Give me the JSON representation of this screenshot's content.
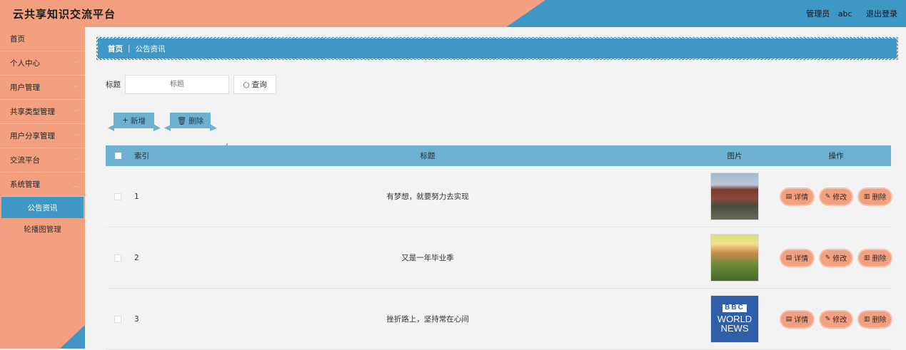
{
  "header": {
    "title": "云共享知识交流平台",
    "role": "管理员",
    "username": "abc",
    "logout": "退出登录"
  },
  "sidebar": {
    "items": [
      {
        "label": "首页"
      },
      {
        "label": "个人中心"
      },
      {
        "label": "用户管理"
      },
      {
        "label": "共享类型管理"
      },
      {
        "label": "用户分享管理"
      },
      {
        "label": "交流平台"
      },
      {
        "label": "系统管理"
      }
    ],
    "sub_items": [
      {
        "label": "公告资讯",
        "active": true
      },
      {
        "label": "轮播图管理",
        "active": false
      }
    ]
  },
  "breadcrumb": {
    "home": "首页",
    "current": "公告资讯"
  },
  "search": {
    "label": "标题",
    "placeholder": "标题",
    "button": "查询"
  },
  "actions": {
    "add": "新增",
    "delete": "删除"
  },
  "table": {
    "headers": {
      "index": "索引",
      "title": "标题",
      "image": "图片",
      "ops": "操作"
    },
    "rows": [
      {
        "index": "1",
        "title": "有梦想，就要努力去实现"
      },
      {
        "index": "2",
        "title": "又是一年毕业季"
      },
      {
        "index": "3",
        "title": "挫折路上，坚持常在心间",
        "image_text": [
          "BBC",
          "WORLD",
          "NEWS"
        ]
      }
    ],
    "row_actions": {
      "detail": "详情",
      "edit": "修改",
      "delete": "删除"
    }
  },
  "colors": {
    "accent_orange": "#f2a07f",
    "accent_blue": "#3f97c6",
    "table_header": "#6eb0cf"
  }
}
